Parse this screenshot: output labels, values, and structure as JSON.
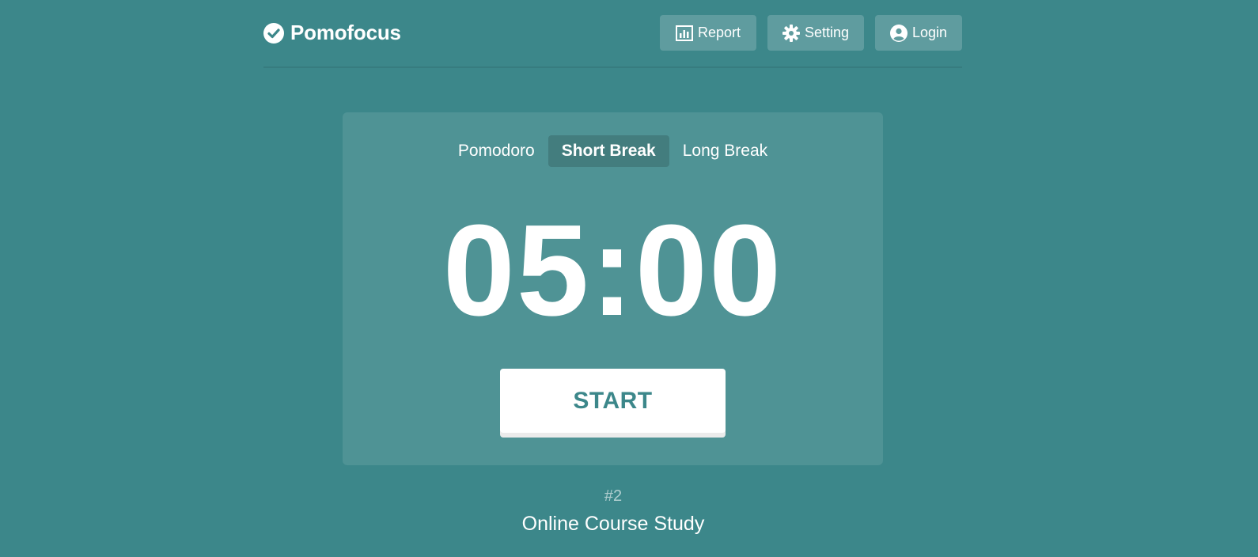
{
  "app": {
    "brand": "Pomofocus",
    "icons": {
      "brand": "check-circle-icon",
      "report": "bar-chart-icon",
      "setting": "gear-icon",
      "login": "user-circle-icon"
    }
  },
  "nav": {
    "report_label": "Report",
    "setting_label": "Setting",
    "login_label": "Login"
  },
  "tabs": [
    {
      "label": "Pomodoro",
      "active": false
    },
    {
      "label": "Short Break",
      "active": true
    },
    {
      "label": "Long Break",
      "active": false
    }
  ],
  "timer": {
    "display": "05:00"
  },
  "controls": {
    "start_label": "START"
  },
  "session": {
    "count": "#2",
    "task": "Online Course Study"
  },
  "colors": {
    "background": "#3c878a",
    "accent_text": "#3c878a"
  }
}
